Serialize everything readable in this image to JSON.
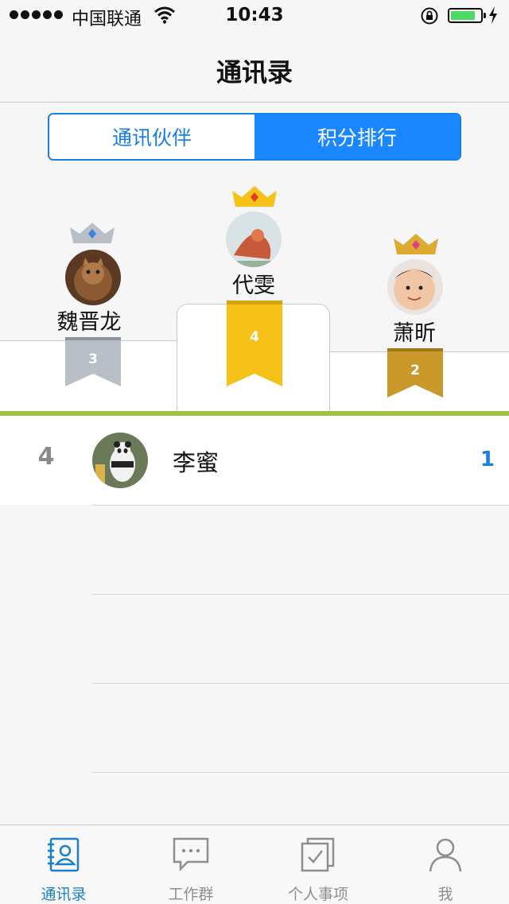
{
  "status_bar": {
    "carrier": "中国联通",
    "time": "10:43"
  },
  "nav": {
    "title": "通讯录"
  },
  "segment": {
    "options": [
      "通讯伙伴",
      "积分排行"
    ],
    "selected_index": 1
  },
  "podium": {
    "first": {
      "name": "代雯",
      "ribbon": "4",
      "crown_color": "#f6c21a",
      "ribbon_color": "#f6c21a"
    },
    "second": {
      "name": "魏晋龙",
      "ribbon": "3",
      "crown_color": "#b9bfc7",
      "ribbon_color": "#b9bfc7"
    },
    "third": {
      "name": "萧昕",
      "ribbon": "2",
      "crown_color": "#dcab2f",
      "ribbon_color": "#c99a2b"
    }
  },
  "ranking_list": [
    {
      "rank": "4",
      "name": "李蜜",
      "score": "1"
    }
  ],
  "tab_bar": {
    "items": [
      {
        "label": "通讯录",
        "icon": "contacts-book-icon",
        "active": true
      },
      {
        "label": "工作群",
        "icon": "chat-bubble-icon",
        "active": false
      },
      {
        "label": "个人事项",
        "icon": "checklist-icon",
        "active": false
      },
      {
        "label": "我",
        "icon": "person-icon",
        "active": false
      }
    ]
  },
  "colors": {
    "accent": "#1a86ff",
    "green_divider": "#a3c042",
    "score": "#1a7fe0"
  }
}
